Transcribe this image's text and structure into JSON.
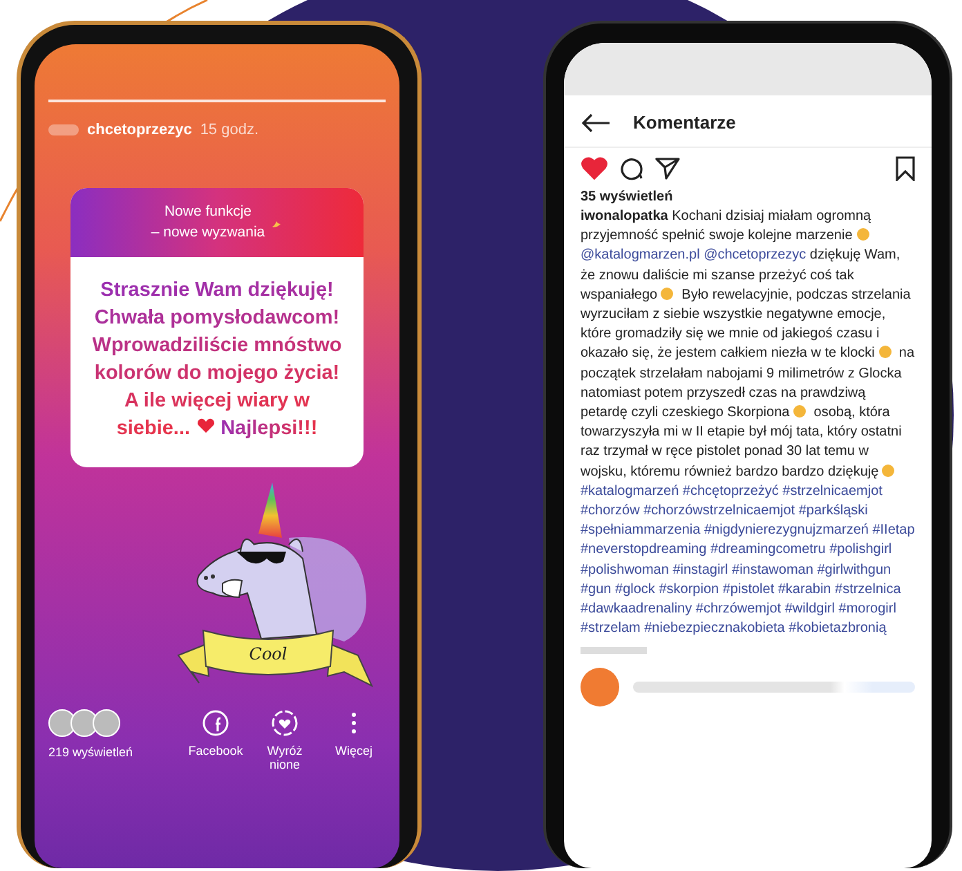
{
  "story": {
    "progress": {
      "level": 1
    },
    "username": "chcetoprzezyc",
    "time": "15 godz.",
    "question": {
      "title": "Nowe funkcje\n– nowe wyzwania",
      "answer_before": "Strasznie Wam dziękuję!\nChwała pomysłodawcom!\nWprowadziliście mnóstwo\nkolorów do mojego życia!\nA ile więcej wiary w\nsiebie...",
      "answer_after": "Najlepsi!!!"
    },
    "sticker_text": "Cool",
    "views": "219 wyświetleń",
    "actions": [
      {
        "kind": "facebook",
        "label": "Facebook"
      },
      {
        "kind": "highlight",
        "label": "Wyróż\nnione"
      },
      {
        "kind": "more",
        "label": "Więcej"
      }
    ]
  },
  "comments": {
    "title": "Komentarze",
    "liked": true,
    "saved": false,
    "views": "35 wyświetleń",
    "post": {
      "author": "iwonalopatka",
      "parts": [
        {
          "kind": "text",
          "text": " Kochani dzisiaj miałam ogromną przyjemność spełnić swoje kolejne marzenie "
        },
        {
          "kind": "emoji"
        },
        {
          "kind": "mention",
          "text": "@katalogmarzen.pl @chcetoprzezyc"
        },
        {
          "kind": "text",
          "text": " dziękuję Wam, że znowu daliście mi szanse przeżyć coś tak wspaniałego "
        },
        {
          "kind": "emoji"
        },
        {
          "kind": "text",
          "text": " Było rewelacyjnie, podczas strzelania wyrzuciłam z siebie wszystkie negatywne emocje, które gromadziły się we mnie od jakiegoś czasu i okazało się, że jestem całkiem niezła w te klocki "
        },
        {
          "kind": "emoji"
        },
        {
          "kind": "text",
          "text": " na początek strzelałam nabojami 9 milimetrów z Glocka natomiast potem przyszedł czas na prawdziwą petardę czyli czeskiego Skorpiona "
        },
        {
          "kind": "emoji"
        },
        {
          "kind": "text",
          "text": " osobą, która towarzyszyła mi w II etapie był mój tata, który ostatni raz trzymał w ręce pistolet ponad 30 lat temu w wojsku, któremu również bardzo bardzo dziękuję "
        },
        {
          "kind": "emoji"
        }
      ]
    },
    "hashtags": "#katalogmarzeń #chcętoprzeżyć #strzelnicaemjot #chorzów #chorzówstrzelnicaemjot #parkśląski #spełniammarzenia #nigdynierezygnujzmarzeń #IIetap #neverstopdreaming #dreamingcometru #polishgirl #polishwoman #instagirl #instawoman #girlwithgun #gun #glock #skorpion #pistolet #karabin #strzelnica #dawkaadrenaliny #chrzówemjot #wildgirl #morogirl #strzelam #niebezpiecznakobieta #kobietazbronią"
  }
}
